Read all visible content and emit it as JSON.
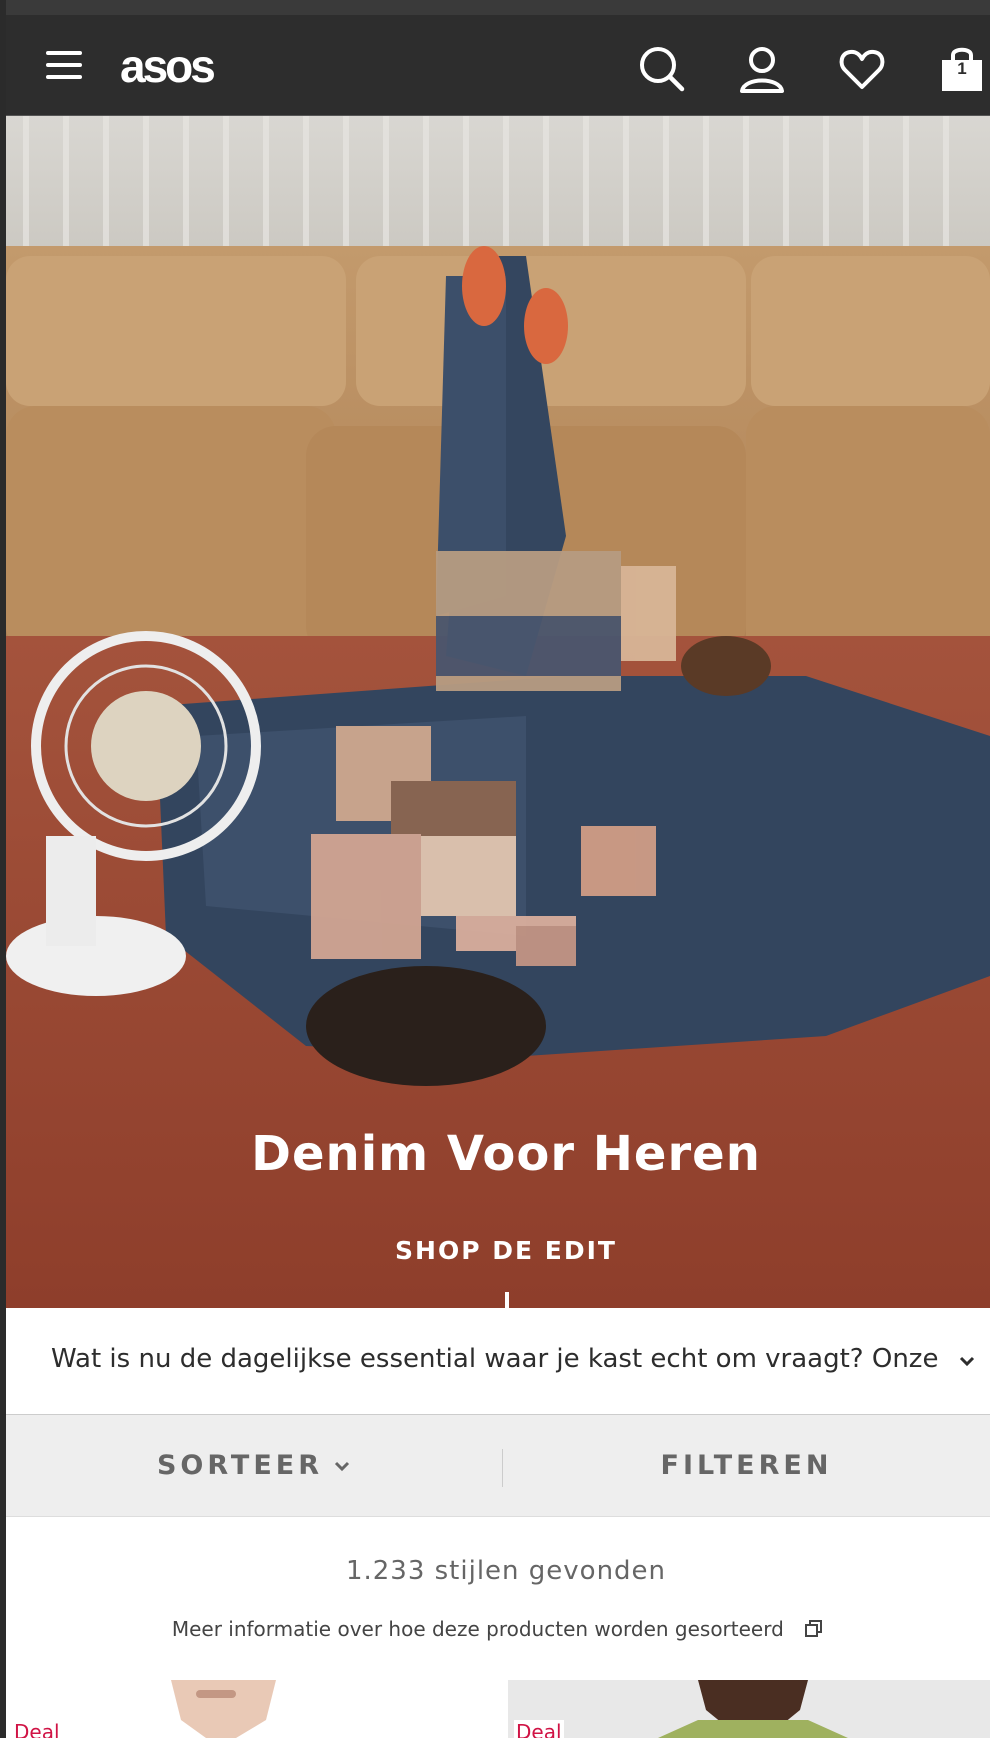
{
  "header": {
    "logo": "asos",
    "bag_count": "1",
    "icons": [
      "menu-icon",
      "search-icon",
      "account-icon",
      "heart-icon",
      "bag-icon"
    ]
  },
  "hero": {
    "title": "Denim Voor Heren",
    "cta": "SHOP DE EDIT"
  },
  "description": {
    "text": "Wat is nu de dagelijkse essential waar je kast echt om vraagt? Onze edit..."
  },
  "toolbar": {
    "sort_label": "SORTEER",
    "filter_label": "FILTEREN"
  },
  "results": {
    "count_text": "1.233 stijlen gevonden",
    "more_info": "Meer informatie over hoe deze producten worden gesorteerd"
  },
  "products": [
    {
      "badge": "Deal"
    },
    {
      "badge": "Deal"
    }
  ],
  "colors": {
    "header_bg": "#2d2d2d",
    "deal_red": "#d01345",
    "toolbar_bg": "#eeeeee"
  }
}
